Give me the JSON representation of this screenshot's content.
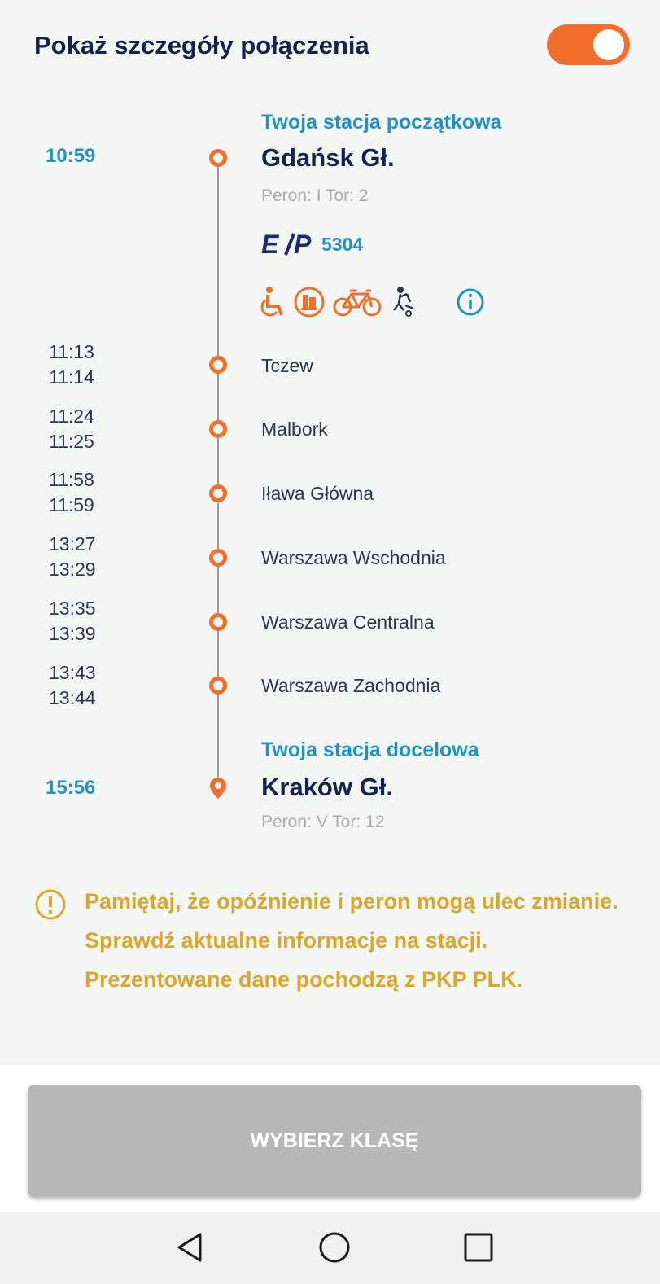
{
  "header": {
    "title": "Pokaż szczegóły połączenia",
    "toggle_on": true
  },
  "origin": {
    "label": "Twoja stacja początkowa",
    "time": "10:59",
    "station": "Gdańsk Gł.",
    "platform": "Peron: I Tor: 2"
  },
  "train": {
    "brand": "EIP",
    "number": "5304"
  },
  "amenities": [
    "wheelchair-icon",
    "wheelchair-lift-icon",
    "bicycle-icon",
    "child-stroller-icon",
    "info-icon"
  ],
  "stops": [
    {
      "arrival": "11:13",
      "departure": "11:14",
      "name": "Tczew"
    },
    {
      "arrival": "11:24",
      "departure": "11:25",
      "name": "Malbork"
    },
    {
      "arrival": "11:58",
      "departure": "11:59",
      "name": "Iława Główna"
    },
    {
      "arrival": "13:27",
      "departure": "13:29",
      "name": "Warszawa Wschodnia"
    },
    {
      "arrival": "13:35",
      "departure": "13:39",
      "name": "Warszawa Centralna"
    },
    {
      "arrival": "13:43",
      "departure": "13:44",
      "name": "Warszawa Zachodnia"
    }
  ],
  "destination": {
    "label": "Twoja stacja docelowa",
    "time": "15:56",
    "station": "Kraków Gł.",
    "platform": "Peron: V Tor: 12"
  },
  "notice": "Pamiętaj, że opóźnienie i peron mogą ulec zmianie. Sprawdź aktualne informacje na stacji. Prezentowane dane pochodzą z PKP PLK.",
  "footer": {
    "button_label": "WYBIERZ KLASĘ"
  },
  "colors": {
    "accent": "#f26e2c",
    "blue": "#1f93c8",
    "navy": "#13234f",
    "notice": "#d9a72c"
  }
}
